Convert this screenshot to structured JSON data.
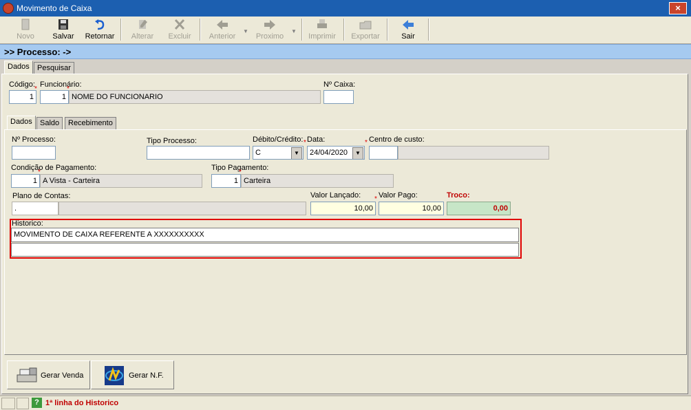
{
  "window": {
    "title": "Movimento de Caixa",
    "close_label": "×"
  },
  "toolbar": {
    "novo": "Novo",
    "salvar": "Salvar",
    "retornar": "Retornar",
    "alterar": "Alterar",
    "excluir": "Excluir",
    "anterior": "Anterior",
    "proximo": "Proximo",
    "imprimir": "Imprimir",
    "exportar": "Exportar",
    "sair": "Sair"
  },
  "process_bar": {
    "label": ">> Processo: ->"
  },
  "top_tabs": {
    "dados": "Dados",
    "pesquisar": "Pesquisar"
  },
  "header_form": {
    "codigo_label": "Código:",
    "codigo_value": "1",
    "funcionario_label": "Funcionário:",
    "funcionario_code": "1",
    "funcionario_name": "NOME DO FUNCIONARIO",
    "caixa_label": "Nº Caixa:",
    "caixa_value": ""
  },
  "inner_tabs": {
    "dados": "Dados",
    "saldo": "Saldo",
    "recebimento": "Recebimento"
  },
  "form": {
    "processo_label": "Nº Processo:",
    "processo_value": "",
    "tipo_processo_label": "Tipo Processo:",
    "tipo_processo_value": "",
    "debito_label": "Débito/Crédito:",
    "debito_value": "C",
    "data_label": "Data:",
    "data_value": "24/04/2020",
    "centro_label": "Centro de custo:",
    "centro_code": "",
    "centro_name": "",
    "condicao_label": "Condição de Pagamento:",
    "condicao_code": "1",
    "condicao_name": "A Vista - Carteira",
    "tipo_pag_label": "Tipo Pagamento:",
    "tipo_pag_code": "1",
    "tipo_pag_name": "Carteira",
    "plano_label": "Plano de Contas:",
    "plano_code": ".",
    "plano_name": "",
    "valor_lancado_label": "Valor Lançado:",
    "valor_lancado_value": "10,00",
    "valor_pago_label": "Valor Pago:",
    "valor_pago_value": "10,00",
    "troco_label": "Troco:",
    "troco_value": "0,00",
    "historico_label": "Historico:",
    "historico_line1": "MOVIMENTO DE CAIXA REFERENTE A XXXXXXXXXX",
    "historico_line2": ""
  },
  "bottom_buttons": {
    "gerar_venda": "Gerar Venda",
    "gerar_nf": "Gerar N.F."
  },
  "status": {
    "help": "?",
    "message": "1ª linha do Historico"
  },
  "colors": {
    "accent": "#a6caf0",
    "required": "#e00000",
    "troco": "#c00000"
  }
}
